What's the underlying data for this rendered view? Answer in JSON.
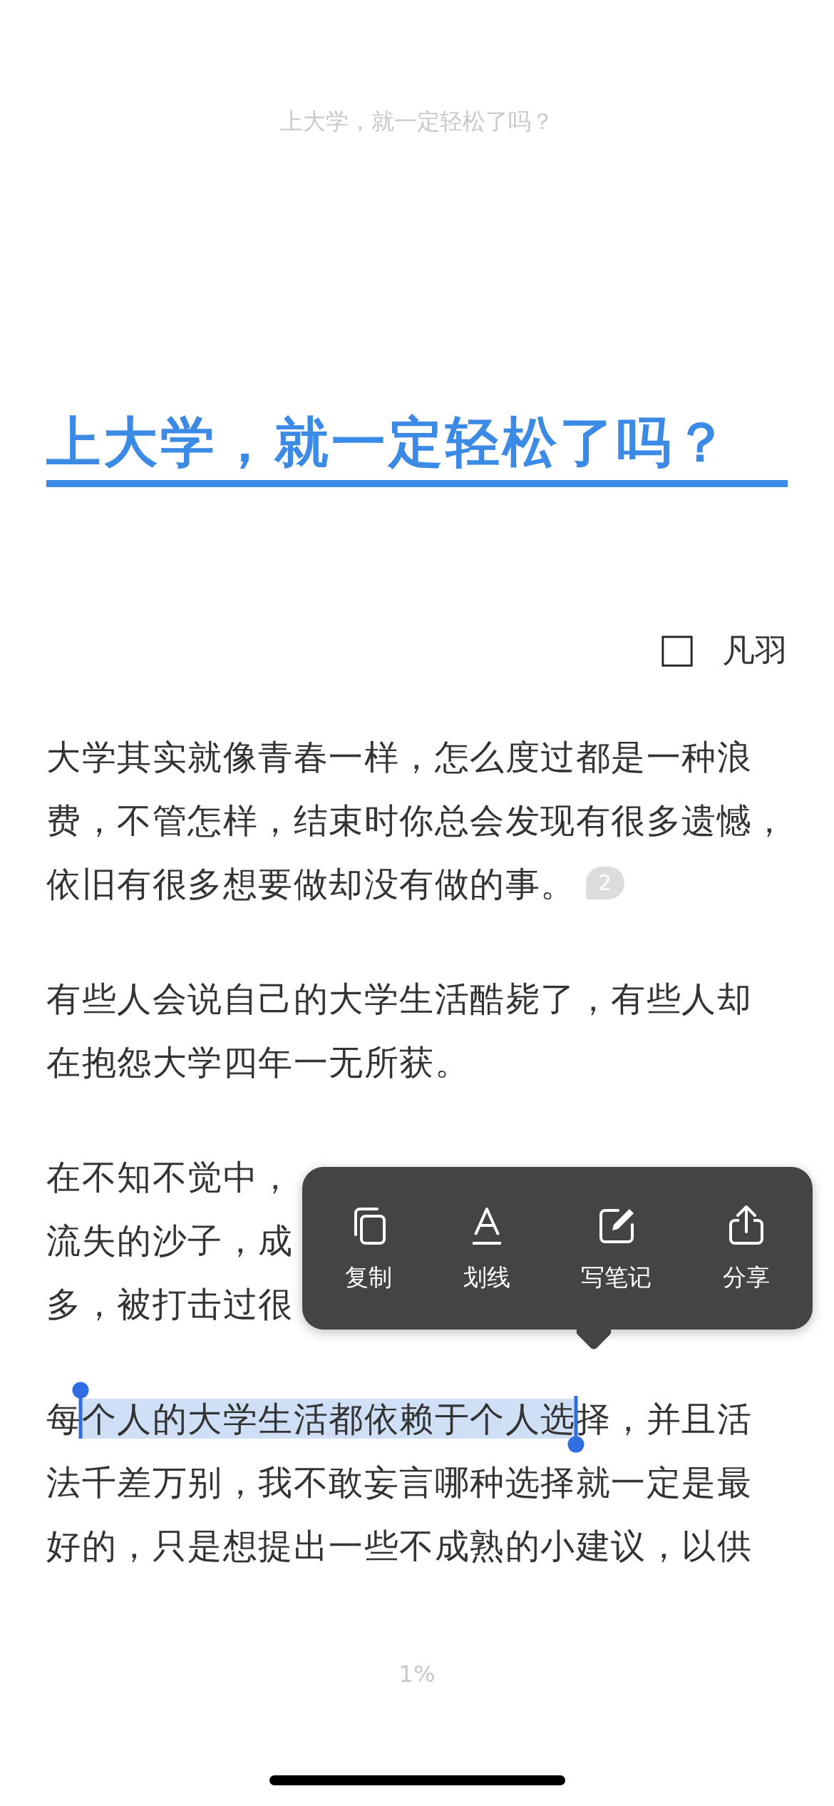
{
  "header": {
    "title": "上大学，就一定轻松了吗？"
  },
  "article": {
    "title": "上大学，就一定轻松了吗？",
    "author": {
      "name": "凡羽"
    },
    "paragraphs": [
      {
        "kind": "text",
        "lines": [
          "大学其实就像青春一样，怎么度过都是一种浪",
          "费，不管怎样，结束时你总会发现有很多遗憾，",
          "依旧有很多想要做却没有做的事。"
        ],
        "footnote": "2"
      },
      {
        "kind": "text",
        "lines": [
          "有些人会说自己的大学生活酷毙了，有些人却",
          "在抱怨大学四年一无所获。"
        ]
      },
      {
        "kind": "covered",
        "fragments": [
          "在不知不觉中，",
          "流失的沙子，成",
          "多，被打击过很"
        ]
      },
      {
        "kind": "selection",
        "before": "每",
        "selected": "个人的大学生活都依赖于个人选",
        "after": "择，并且活",
        "lines": [
          "法千差万别，我不敢妄言哪种选择就一定是最",
          "好的，只是想提出一些不成熟的小建议，以供"
        ]
      }
    ]
  },
  "popup_menu": {
    "items": [
      {
        "kind": "copy",
        "label": "复制"
      },
      {
        "kind": "underline",
        "label": "划线"
      },
      {
        "kind": "note",
        "label": "写笔记"
      },
      {
        "kind": "share",
        "label": "分享"
      }
    ]
  },
  "progress": "1%"
}
